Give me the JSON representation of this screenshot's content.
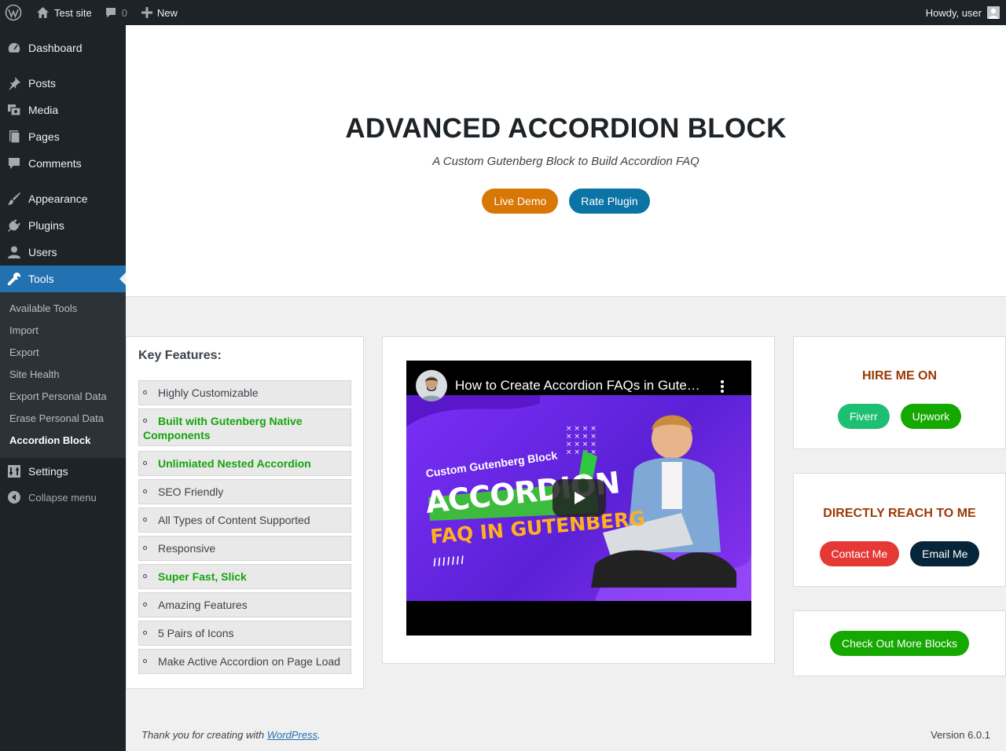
{
  "adminbar": {
    "site_name": "Test site",
    "comments_count": "0",
    "new_label": "New",
    "greeting": "Howdy, user"
  },
  "sidebar": {
    "items": [
      {
        "label": "Dashboard",
        "icon": "dashboard-icon"
      },
      {
        "label": "Posts",
        "icon": "pin-icon"
      },
      {
        "label": "Media",
        "icon": "media-icon"
      },
      {
        "label": "Pages",
        "icon": "pages-icon"
      },
      {
        "label": "Comments",
        "icon": "comment-icon"
      },
      {
        "label": "Appearance",
        "icon": "brush-icon"
      },
      {
        "label": "Plugins",
        "icon": "plug-icon"
      },
      {
        "label": "Users",
        "icon": "user-icon"
      },
      {
        "label": "Tools",
        "icon": "wrench-icon"
      },
      {
        "label": "Settings",
        "icon": "settings-icon"
      }
    ],
    "submenu": [
      "Available Tools",
      "Import",
      "Export",
      "Site Health",
      "Export Personal Data",
      "Erase Personal Data",
      "Accordion Block"
    ],
    "collapse_label": "Collapse menu"
  },
  "hero": {
    "title": "ADVANCED ACCORDION BLOCK",
    "subtitle": "A Custom Gutenberg Block to Build Accordion FAQ",
    "live_demo": "Live Demo",
    "rate_plugin": "Rate Plugin"
  },
  "features": {
    "heading": "Key Features:",
    "items": [
      "Highly Customizable",
      "Built with Gutenberg Native Components",
      "Unlimiated Nested Accordion",
      "SEO Friendly",
      "All Types of Content Supported",
      "Responsive",
      "Super Fast, Slick",
      "Amazing Features",
      "5 Pairs of Icons",
      "Make Active Accordion on Page Load"
    ]
  },
  "video": {
    "title": "How to Create Accordion FAQs in Gute…",
    "thumb_kicker": "Custom Gutenberg Block",
    "thumb_big": "ACCORDION",
    "thumb_sub": "FAQ IN GUTENBERG",
    "thumb_slashes": "///////"
  },
  "hire": {
    "heading": "HIRE ME ON",
    "fiverr": "Fiverr",
    "upwork": "Upwork"
  },
  "reach": {
    "heading": "DIRECTLY REACH TO ME",
    "contact": "Contact Me",
    "email": "Email Me"
  },
  "more": {
    "label": "Check Out More Blocks"
  },
  "footer": {
    "thanks_prefix": "Thank you for creating with ",
    "link": "WordPress",
    "suffix": ".",
    "version": "Version 6.0.1"
  },
  "colors": {
    "live_demo": "#d97706",
    "rate_plugin": "#0b74a4",
    "fiverr": "#1dbf73",
    "upwork": "#14a800",
    "contact": "#e53935",
    "email": "#06253a",
    "more_blocks": "#14a800",
    "highlight_text": "#13a50b",
    "admin_blue": "#2271b1"
  }
}
